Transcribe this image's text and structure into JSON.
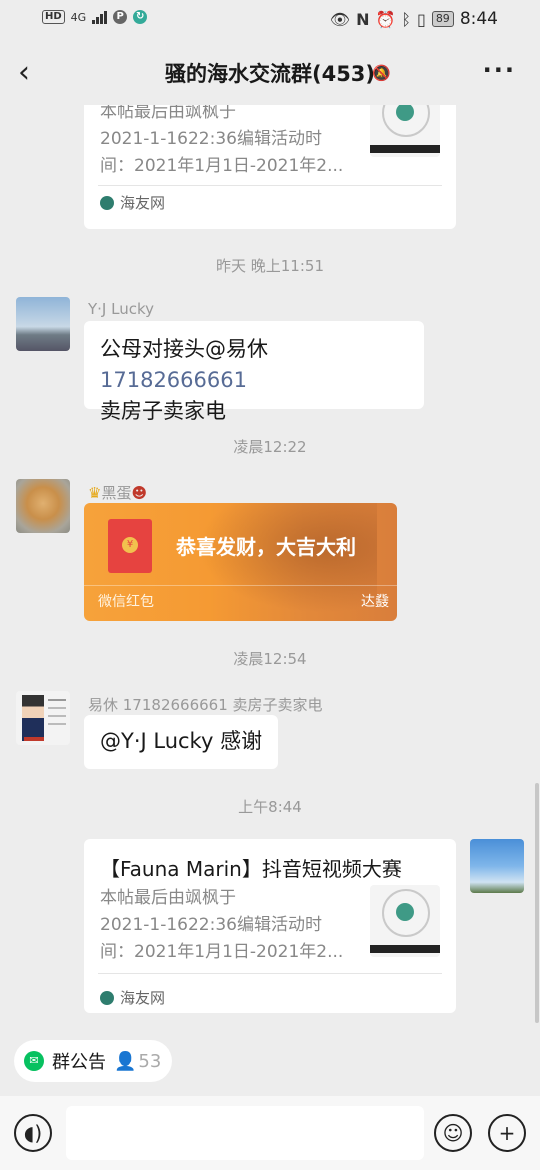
{
  "status_bar": {
    "hd": "HD",
    "network": "4G",
    "battery": "89",
    "time": "8:44"
  },
  "header": {
    "title": "骚的海水交流群(453)"
  },
  "messages": {
    "link_card_top": {
      "desc_lines": [
        "本帖最后由飒枫于",
        "2021-1-1622:36编辑活动时",
        "间：2021年1月1日-2021年2..."
      ],
      "source": "海友网"
    },
    "time_1": "昨天 晚上11:51",
    "msg_1": {
      "sender": "Y·J Lucky",
      "line1_prefix": "公母对接头@易休 ",
      "line1_mention": "17182666661",
      "line2": "卖房子卖家电"
    },
    "time_2": "凌晨12:22",
    "msg_2": {
      "sender": "黑蛋",
      "greeting": "恭喜发财，大吉大利",
      "footer": "微信红包",
      "sticker": "达鼗"
    },
    "time_3": "凌晨12:54",
    "msg_3": {
      "sender": "易休  17182666661 卖房子卖家电",
      "text": "@Y·J Lucky  感谢"
    },
    "time_4": "上午8:44",
    "msg_4": {
      "title": "【Fauna Marin】抖音短视频大赛",
      "desc_lines": [
        "本帖最后由飒枫于",
        "2021-1-1622:36编辑活动时",
        "间：2021年1月1日-2021年2..."
      ],
      "source": "海友网"
    }
  },
  "bottom": {
    "notice_label": "群公告",
    "member_count": "53"
  },
  "colors": {
    "background": "#ededed",
    "accent_green": "#07c160",
    "mention_blue": "#576b95",
    "red_packet_orange": "#f59a33"
  }
}
